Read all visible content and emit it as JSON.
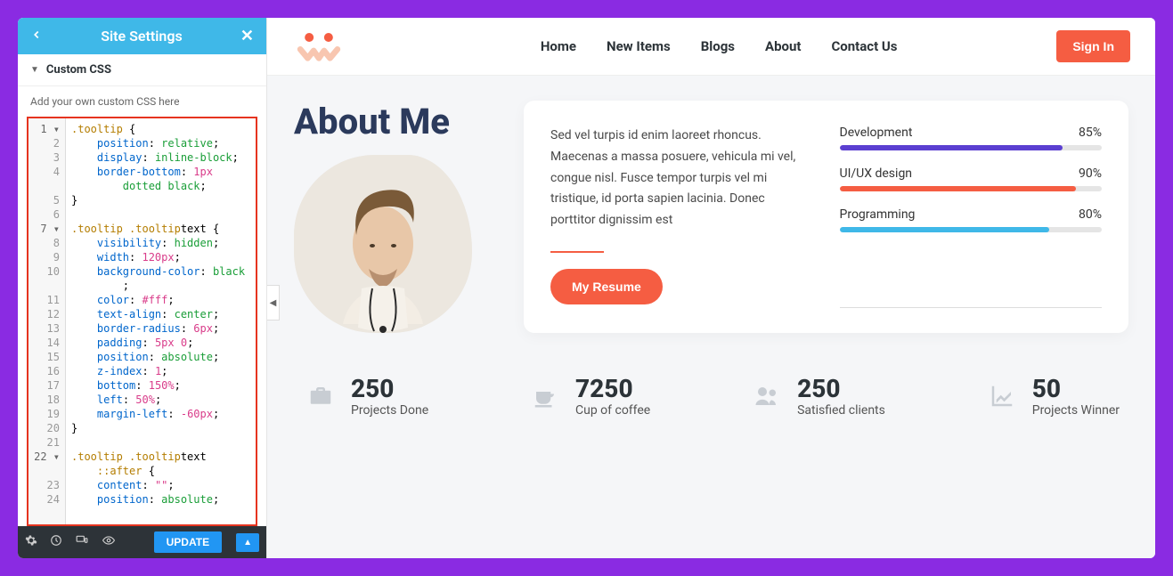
{
  "sidebar": {
    "title": "Site Settings",
    "section_label": "Custom CSS",
    "hint": "Add your own custom CSS here",
    "update_label": "UPDATE",
    "code_lines": [
      {
        "n": "1",
        "fold": true
      },
      {
        "n": "2"
      },
      {
        "n": "3"
      },
      {
        "n": "4"
      },
      {
        "n": ""
      },
      {
        "n": "5"
      },
      {
        "n": "6"
      },
      {
        "n": "7",
        "fold": true
      },
      {
        "n": "8"
      },
      {
        "n": "9"
      },
      {
        "n": "10"
      },
      {
        "n": ""
      },
      {
        "n": "11"
      },
      {
        "n": "12"
      },
      {
        "n": "13"
      },
      {
        "n": "14"
      },
      {
        "n": "15"
      },
      {
        "n": "16"
      },
      {
        "n": "17"
      },
      {
        "n": "18"
      },
      {
        "n": "19"
      },
      {
        "n": "20"
      },
      {
        "n": "21"
      },
      {
        "n": "22",
        "fold": true
      },
      {
        "n": ""
      },
      {
        "n": "23"
      },
      {
        "n": "24"
      }
    ],
    "code": ".tooltip {\n    position: relative;\n    display: inline-block;\n    border-bottom: 1px \n        dotted black;\n}\n\n.tooltip .tooltiptext {\n    visibility: hidden;\n    width: 120px;\n    background-color: black\n        ;\n    color: #fff;\n    text-align: center;\n    border-radius: 6px;\n    padding: 5px 0;\n    position: absolute;\n    z-index: 1;\n    bottom: 150%;\n    left: 50%;\n    margin-left: -60px;\n}\n\n.tooltip .tooltiptext\n    ::after {\n    content: \"\";\n    position: absolute;"
  },
  "nav": {
    "items": [
      "Home",
      "New Items",
      "Blogs",
      "About",
      "Contact Us"
    ],
    "signin": "Sign In"
  },
  "about": {
    "title": "About Me",
    "paragraph": "Sed vel turpis id enim laoreet rhoncus. Maecenas a massa posuere, vehicula mi vel, congue nisl. Fusce tempor turpis vel mi tristique, id porta sapien lacinia. Donec porttitor dignissim est",
    "resume_btn": "My Resume",
    "skills": [
      {
        "name": "Development",
        "pct": "85%",
        "width": "85%",
        "color": "#5b3fd1"
      },
      {
        "name": "UI/UX design",
        "pct": "90%",
        "width": "90%",
        "color": "#f55d42"
      },
      {
        "name": "Programming",
        "pct": "80%",
        "width": "80%",
        "color": "#3fb8e8"
      }
    ]
  },
  "stats": [
    {
      "num": "250",
      "label": "Projects Done",
      "icon": "briefcase"
    },
    {
      "num": "7250",
      "label": "Cup of coffee",
      "icon": "coffee"
    },
    {
      "num": "250",
      "label": "Satisfied clients",
      "icon": "users"
    },
    {
      "num": "50",
      "label": "Projects Winner",
      "icon": "chart"
    }
  ]
}
